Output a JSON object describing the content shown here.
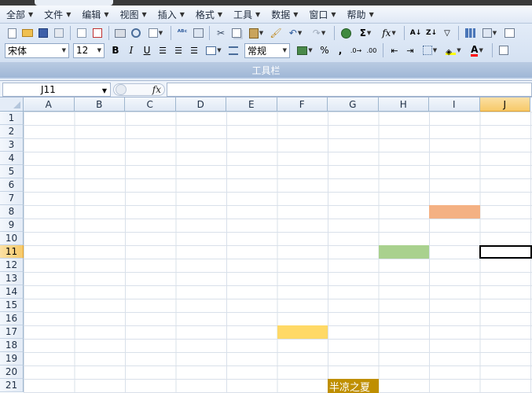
{
  "menu": {
    "items": [
      {
        "name": "menu-all",
        "label": "全部"
      },
      {
        "name": "menu-file",
        "label": "文件"
      },
      {
        "name": "menu-edit",
        "label": "编辑"
      },
      {
        "name": "menu-view",
        "label": "视图"
      },
      {
        "name": "menu-insert",
        "label": "插入"
      },
      {
        "name": "menu-format",
        "label": "格式"
      },
      {
        "name": "menu-tools",
        "label": "工具"
      },
      {
        "name": "menu-data",
        "label": "数据"
      },
      {
        "name": "menu-window",
        "label": "窗口"
      },
      {
        "name": "menu-help",
        "label": "帮助"
      }
    ]
  },
  "toolbar": {
    "font_name": "宋体",
    "font_size": "12",
    "bold": "B",
    "italic": "I",
    "underline": "U",
    "number_format": "常规",
    "percent": "%",
    "comma": ",",
    "sigma": "Σ",
    "fx": "fx",
    "group_label": "工具栏",
    "font_color": "#ff0000",
    "fill_color": "#ffff00"
  },
  "formula_bar": {
    "name_box": "J11",
    "fx_label": "fx",
    "formula": ""
  },
  "sheet": {
    "columns": [
      "A",
      "B",
      "C",
      "D",
      "E",
      "F",
      "G",
      "H",
      "I",
      "J"
    ],
    "rows": [
      "1",
      "2",
      "3",
      "4",
      "5",
      "6",
      "7",
      "8",
      "9",
      "10",
      "11",
      "12",
      "13",
      "14",
      "15",
      "16",
      "17",
      "18",
      "19",
      "20",
      "21"
    ],
    "active_column": "J",
    "active_row": "11",
    "cells": {
      "I8": {
        "fill": "#f4b183"
      },
      "H11": {
        "fill": "#a9d18e"
      },
      "F17": {
        "fill": "#ffd966"
      },
      "G21": {
        "fill": "#bf8f00",
        "text": "半凉之夏",
        "color": "#ffffff"
      }
    }
  }
}
